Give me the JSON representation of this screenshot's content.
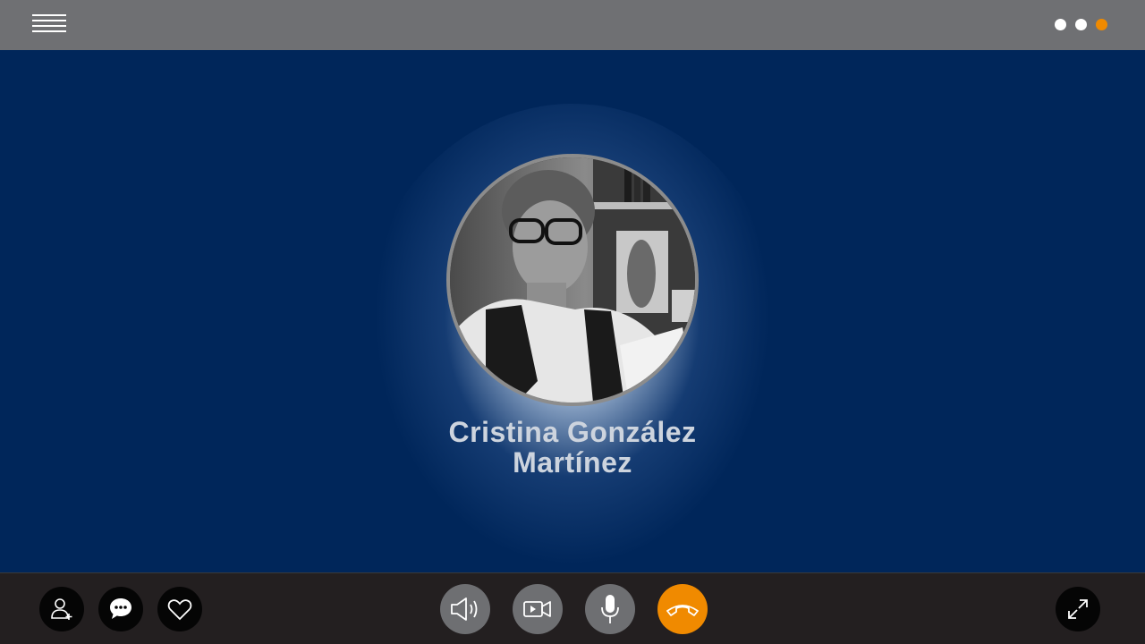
{
  "contact": {
    "name_line1": "Cristina González",
    "name_line2": "Martínez"
  },
  "pager": {
    "total": 3,
    "active": 3
  },
  "colors": {
    "topbar": "#6f7073",
    "stage": "#00265a",
    "bottombar": "#231f20",
    "accent": "#f08a00",
    "control_gray": "#6e6f72"
  },
  "icons": {
    "menu": "hamburger-icon",
    "add_contact": "add-contact-icon",
    "chat": "chat-bubble-icon",
    "favorite": "heart-icon",
    "speaker": "speaker-icon",
    "video": "video-camera-icon",
    "microphone": "microphone-icon",
    "hang_up": "phone-hangup-icon",
    "fullscreen": "expand-icon"
  }
}
